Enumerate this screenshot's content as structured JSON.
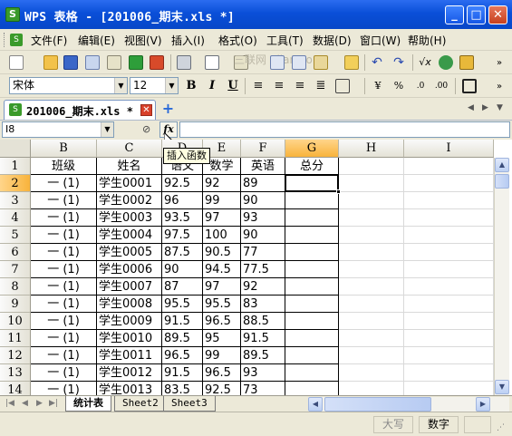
{
  "window": {
    "title": "WPS 表格 - [201006_期末.xls *]",
    "minimize": "_",
    "maximize": "□",
    "close": "✕"
  },
  "menu": [
    "文件(F)",
    "编辑(E)",
    "视图(V)",
    "插入(I)",
    "格式(O)",
    "工具(T)",
    "数据(D)",
    "窗口(W)",
    "帮助(H)"
  ],
  "watermark": "三联网 3lian.com",
  "format_bar": {
    "font_name": "宋体",
    "font_size": "12",
    "bold": "B",
    "italic": "I",
    "underline": "U"
  },
  "doc_tab": {
    "name": "201006_期末.xls *",
    "new_tab": "+"
  },
  "formula_bar": {
    "name_box": "I8",
    "cancel": "⊘",
    "fx": "fx",
    "tooltip": "插入函数",
    "formula": ""
  },
  "sheet": {
    "columns": [
      "B",
      "C",
      "D",
      "E",
      "F",
      "G",
      "H",
      "I"
    ],
    "active_column": "G",
    "active_row": "2",
    "header_row": [
      "班级",
      "姓名",
      "语文",
      "数学",
      "英语",
      "总分"
    ],
    "rows": [
      {
        "n": "2",
        "cls": "一 (1)",
        "name": "学生0001",
        "yw": "92.5",
        "sx": "92",
        "yy": "89"
      },
      {
        "n": "3",
        "cls": "一 (1)",
        "name": "学生0002",
        "yw": "96",
        "sx": "99",
        "yy": "90"
      },
      {
        "n": "4",
        "cls": "一 (1)",
        "name": "学生0003",
        "yw": "93.5",
        "sx": "97",
        "yy": "93"
      },
      {
        "n": "5",
        "cls": "一 (1)",
        "name": "学生0004",
        "yw": "97.5",
        "sx": "100",
        "yy": "90"
      },
      {
        "n": "6",
        "cls": "一 (1)",
        "name": "学生0005",
        "yw": "87.5",
        "sx": "90.5",
        "yy": "77"
      },
      {
        "n": "7",
        "cls": "一 (1)",
        "name": "学生0006",
        "yw": "90",
        "sx": "94.5",
        "yy": "77.5"
      },
      {
        "n": "8",
        "cls": "一 (1)",
        "name": "学生0007",
        "yw": "87",
        "sx": "97",
        "yy": "92"
      },
      {
        "n": "9",
        "cls": "一 (1)",
        "name": "学生0008",
        "yw": "95.5",
        "sx": "95.5",
        "yy": "83"
      },
      {
        "n": "10",
        "cls": "一 (1)",
        "name": "学生0009",
        "yw": "91.5",
        "sx": "96.5",
        "yy": "88.5"
      },
      {
        "n": "11",
        "cls": "一 (1)",
        "name": "学生0010",
        "yw": "89.5",
        "sx": "95",
        "yy": "91.5"
      },
      {
        "n": "12",
        "cls": "一 (1)",
        "name": "学生0011",
        "yw": "96.5",
        "sx": "99",
        "yy": "89.5"
      },
      {
        "n": "13",
        "cls": "一 (1)",
        "name": "学生0012",
        "yw": "91.5",
        "sx": "96.5",
        "yy": "93"
      },
      {
        "n": "14",
        "cls": "一 (1)",
        "name": "学生0013",
        "yw": "83.5",
        "sx": "92.5",
        "yy": "73"
      }
    ]
  },
  "sheet_tabs": [
    "统计表",
    "Sheet2",
    "Sheet3"
  ],
  "active_sheet": "统计表",
  "status": {
    "caps": "大写",
    "num": "数字"
  },
  "colors": {
    "title_bar": "#0a4fd8",
    "chrome": "#ece9d8",
    "active_header": "#f8b33c",
    "tooltip_bg": "#ffffe1"
  }
}
